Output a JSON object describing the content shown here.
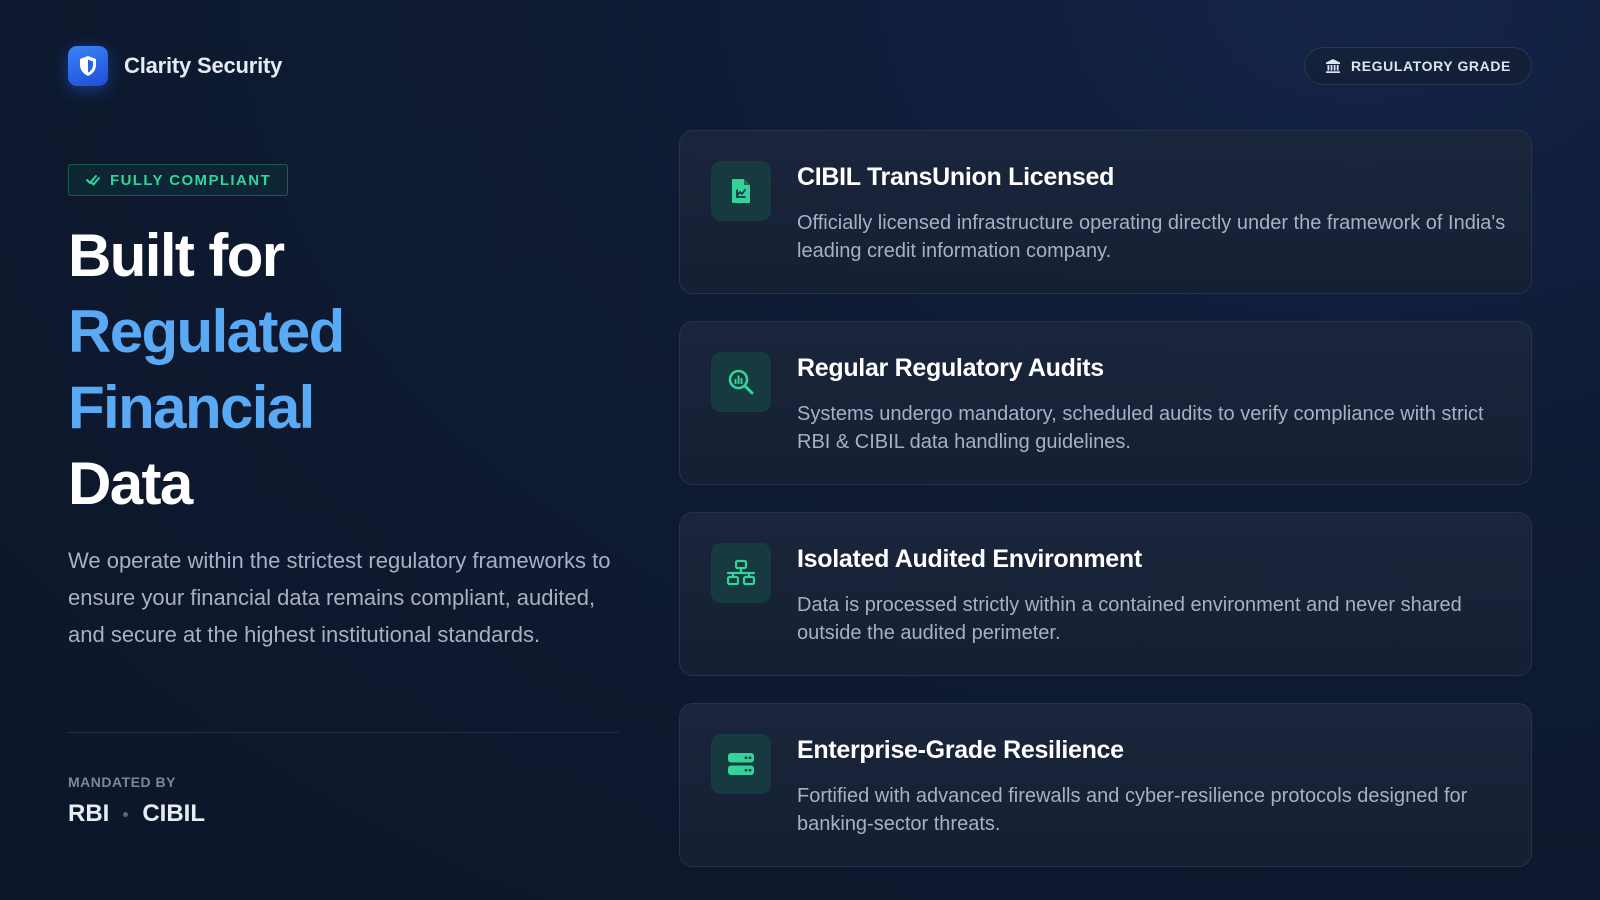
{
  "brand": {
    "name": "Clarity Security",
    "icon": "shield-icon",
    "accent": "#2563eb"
  },
  "header": {
    "pill_label": "REGULATORY GRADE",
    "pill_icon": "bank-icon"
  },
  "hero": {
    "badge": "FULLY COMPLIANT",
    "badge_icon": "check-icon",
    "badge_color": "#34d399",
    "headline_lines": [
      "Built for",
      "Regulated",
      "Financial",
      "Data"
    ],
    "headline_accent_color": "#5aa9f5",
    "description": "We operate within the strictest regulatory frameworks to ensure your financial data remains compliant, audited, and secure at the highest institutional standards.",
    "mandated_label": "MANDATED BY",
    "mandated_by": [
      "RBI",
      "CIBIL"
    ]
  },
  "cards": [
    {
      "title": "CIBIL TransUnion Licensed",
      "description": "Officially licensed infrastructure operating directly under the framework of India's leading credit information company.",
      "icon": "license-document-icon"
    },
    {
      "title": "Regular Regulatory Audits",
      "description": "Systems undergo mandatory, scheduled audits to verify compliance with strict RBI & CIBIL data handling guidelines.",
      "icon": "audit-search-icon"
    },
    {
      "title": "Isolated Audited Environment",
      "description": "Data is processed strictly within a contained environment and never shared outside the audited perimeter.",
      "icon": "network-icon"
    },
    {
      "title": "Enterprise-Grade Resilience",
      "description": "Fortified with advanced firewalls and cyber-resilience protocols designed for banking-sector threats.",
      "icon": "server-icon"
    }
  ]
}
